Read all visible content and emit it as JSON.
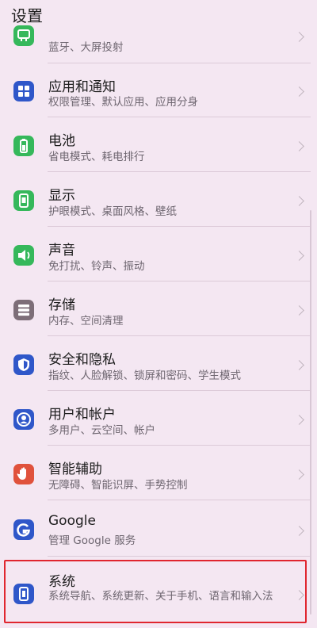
{
  "header": {
    "title": "设置"
  },
  "items": [
    {
      "title": "",
      "subtitle": "蓝牙、大屏投射",
      "icon": "projection-icon",
      "color": "#35b85b"
    },
    {
      "title": "应用和通知",
      "subtitle": "权限管理、默认应用、应用分身",
      "icon": "apps-icon",
      "color": "#2f57c9"
    },
    {
      "title": "电池",
      "subtitle": "省电模式、耗电排行",
      "icon": "battery-icon",
      "color": "#35b85b"
    },
    {
      "title": "显示",
      "subtitle": "护眼模式、桌面风格、壁纸",
      "icon": "display-icon",
      "color": "#35b85b"
    },
    {
      "title": "声音",
      "subtitle": "免打扰、铃声、振动",
      "icon": "sound-icon",
      "color": "#35b85b"
    },
    {
      "title": "存储",
      "subtitle": "内存、空间清理",
      "icon": "storage-icon",
      "color": "#7d6e78"
    },
    {
      "title": "安全和隐私",
      "subtitle": "指纹、人脸解锁、锁屏和密码、学生模式",
      "icon": "shield-icon",
      "color": "#2f57c9"
    },
    {
      "title": "用户和帐户",
      "subtitle": "多用户、云空间、帐户",
      "icon": "user-icon",
      "color": "#2f57c9"
    },
    {
      "title": "智能辅助",
      "subtitle": "无障碍、智能识屏、手势控制",
      "icon": "hand-icon",
      "color": "#e0523c"
    },
    {
      "title": "Google",
      "subtitle": "管理 Google 服务",
      "icon": "google-icon",
      "color": "#2f57c9"
    },
    {
      "title": "系统",
      "subtitle": "系统导航、系统更新、关于手机、语言和输入法",
      "icon": "phone-icon",
      "color": "#2f57c9"
    }
  ]
}
